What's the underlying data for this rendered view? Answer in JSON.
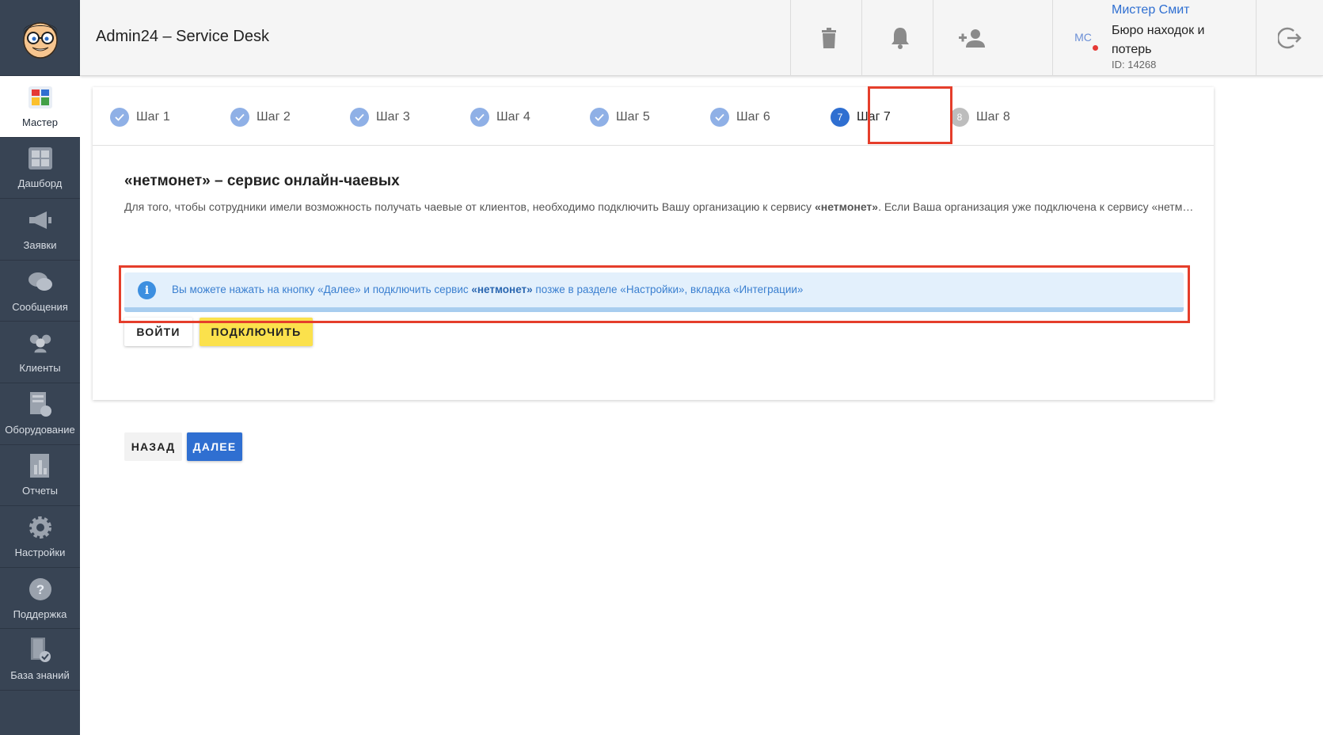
{
  "app": {
    "title": "Admin24 – Service Desk"
  },
  "sidebar": {
    "items": [
      {
        "label": "Мастер",
        "icon": "wizard-icon",
        "active": true
      },
      {
        "label": "Дашборд",
        "icon": "dashboard-icon"
      },
      {
        "label": "Заявки",
        "icon": "megaphone-icon"
      },
      {
        "label": "Сообщения",
        "icon": "chat-icon"
      },
      {
        "label": "Клиенты",
        "icon": "clients-icon"
      },
      {
        "label": "Оборудование",
        "icon": "equipment-icon"
      },
      {
        "label": "Отчеты",
        "icon": "reports-icon"
      },
      {
        "label": "Настройки",
        "icon": "gear-icon"
      },
      {
        "label": "Поддержка",
        "icon": "help-icon"
      },
      {
        "label": "База знаний",
        "icon": "knowledge-base-icon"
      }
    ]
  },
  "header": {
    "buttons": [
      "trash-icon",
      "bell-icon",
      "add-user-icon",
      "logout-icon"
    ],
    "user": {
      "initials": "МС",
      "name": "Мистер Смит",
      "org": "Бюро находок и потерь",
      "id": "ID: 14268"
    }
  },
  "stepper": {
    "steps": [
      {
        "label": "Шаг 1",
        "status": "done",
        "num": ""
      },
      {
        "label": "Шаг 2",
        "status": "done",
        "num": ""
      },
      {
        "label": "Шаг 3",
        "status": "done",
        "num": ""
      },
      {
        "label": "Шаг 4",
        "status": "done",
        "num": ""
      },
      {
        "label": "Шаг 5",
        "status": "done",
        "num": ""
      },
      {
        "label": "Шаг 6",
        "status": "done",
        "num": ""
      },
      {
        "label": "Шаг 7",
        "status": "current",
        "num": "7"
      },
      {
        "label": "Шаг 8",
        "status": "pending",
        "num": "8"
      }
    ]
  },
  "content": {
    "title": "«нетмонет» – сервис онлайн-чаевых",
    "desc_pre": "Для того, чтобы сотрудники имели возможность получать чаевые от клиентов, необходимо подключить Вашу организацию к сервису ",
    "desc_bold": "«нетмонет»",
    "desc_post": ". Если Ваша организация уже подключена к сервису «нетмонет», нажмите кнопку «Войти».",
    "login_label": "Войти",
    "connect_label": "Подключить",
    "info_pre": "Вы можете нажать на кнопку «Далее» и подключить сервис ",
    "info_bold": "«нетмонет»",
    "info_post": " позже в разделе «Настройки», вкладка «Интеграции»",
    "info_icon": "i",
    "back_label": "Назад",
    "next_label": "Далее"
  },
  "colors": {
    "sidebar": "#384454",
    "accent": "#2f6fd1",
    "connect": "#fbe14c",
    "highlight": "#e53e2b",
    "info_bg": "#e3f0fc"
  }
}
